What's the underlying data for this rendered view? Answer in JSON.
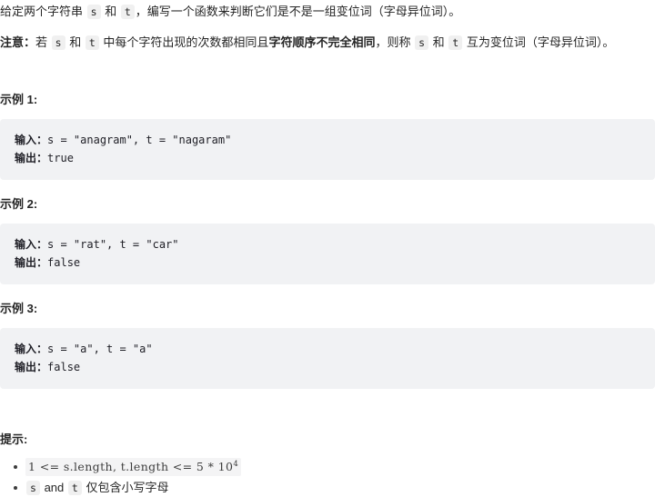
{
  "problem": {
    "intro": {
      "prefix": "给定两个字符串",
      "code_s": "s",
      "mid": "和",
      "code_t": "t",
      "suffix": "，编写一个函数来判断它们是不是一组变位词（字母异位词）。"
    },
    "note": {
      "label": "注意：",
      "part1": "若",
      "code_s": "s",
      "and1": "和",
      "code_t": "t",
      "part2": "中每个字符出现的次数都相同且",
      "bold": "字符顺序不完全相同",
      "part3": "，则称",
      "code_s2": "s",
      "and2": "和",
      "code_t2": "t",
      "part4": "互为变位词（字母异位词）。"
    },
    "examples": [
      {
        "heading": "示例 1:",
        "input_label": "输入：",
        "input_value": "s = \"anagram\", t = \"nagaram\"",
        "output_label": "输出：",
        "output_value": "true"
      },
      {
        "heading": "示例 2:",
        "input_label": "输入：",
        "input_value": "s = \"rat\", t = \"car\"",
        "output_label": "输出：",
        "output_value": "false"
      },
      {
        "heading": "示例 3:",
        "input_label": "输入：",
        "input_value": "s = \"a\", t = \"a\"",
        "output_label": "输出：",
        "output_value": "false"
      }
    ],
    "hints": {
      "heading": "提示:",
      "items": [
        {
          "math_base": "1 <= s.length, t.length <= 5 * 10",
          "math_exp": "4"
        },
        {
          "code_s": "s",
          "and": "and",
          "code_t": "t",
          "text": "仅包含小写字母"
        }
      ]
    }
  },
  "colors": {
    "page_bg": "#ffffff",
    "text": "#262626",
    "code_block_bg": "#f1f2f4",
    "inline_code_bg": "#f0f0f0",
    "bullet": "#3c3c3c"
  }
}
